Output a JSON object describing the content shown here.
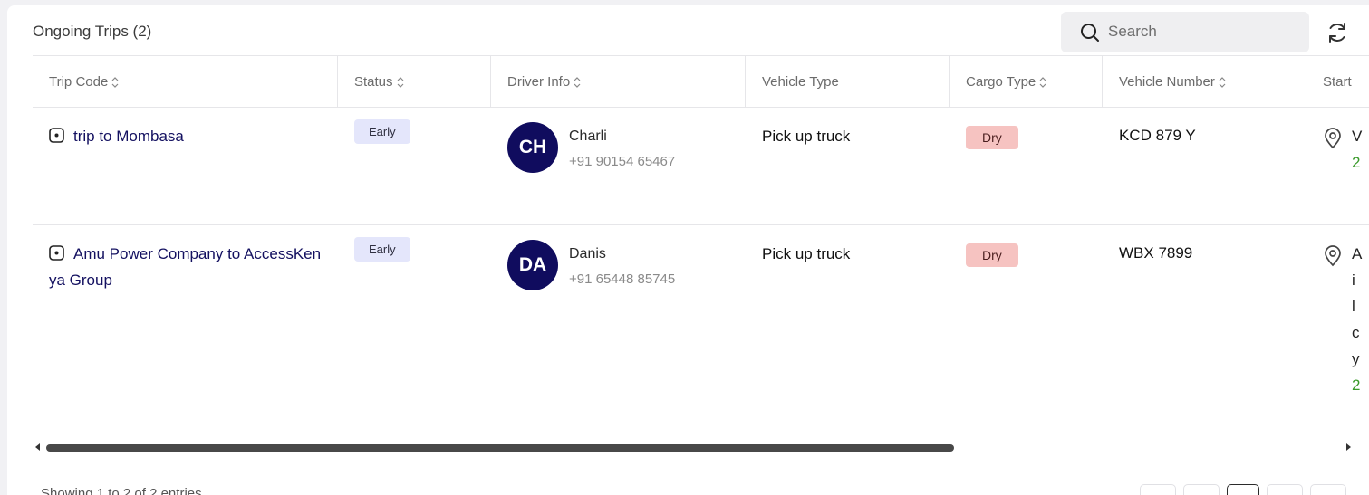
{
  "header": {
    "title": "Ongoing Trips (2)",
    "search_placeholder": "Search"
  },
  "columns": [
    "Trip Code",
    "Status",
    "Driver Info",
    "Vehicle Type",
    "Cargo Type",
    "Vehicle Number",
    "Start"
  ],
  "rows": [
    {
      "trip_code": "trip to Mombasa",
      "status": "Early",
      "driver_initials": "CH",
      "driver_name": "Charli",
      "driver_phone": "+91 90154 65467",
      "vehicle_type": "Pick up truck",
      "cargo_type": "Dry",
      "vehicle_number": "KCD 879 Y",
      "start_fragments": [
        "V",
        "2"
      ]
    },
    {
      "trip_code": "Amu Power Company to AccessKenya Group",
      "status": "Early",
      "driver_initials": "DA",
      "driver_name": "Danis",
      "driver_phone": "+91 65448 85745",
      "vehicle_type": "Pick up truck",
      "cargo_type": "Dry",
      "vehicle_number": "WBX 7899",
      "start_fragments": [
        "A",
        "i",
        "l",
        "c",
        "y",
        "2"
      ]
    }
  ],
  "footer": {
    "info": "Showing 1 to 2 of 2 entries"
  },
  "colors": {
    "brand_navy": "#100c5e",
    "status_bg": "#e4e6fb",
    "cargo_bg": "#f6c3c1",
    "start_date_green": "#3a9a2a"
  }
}
